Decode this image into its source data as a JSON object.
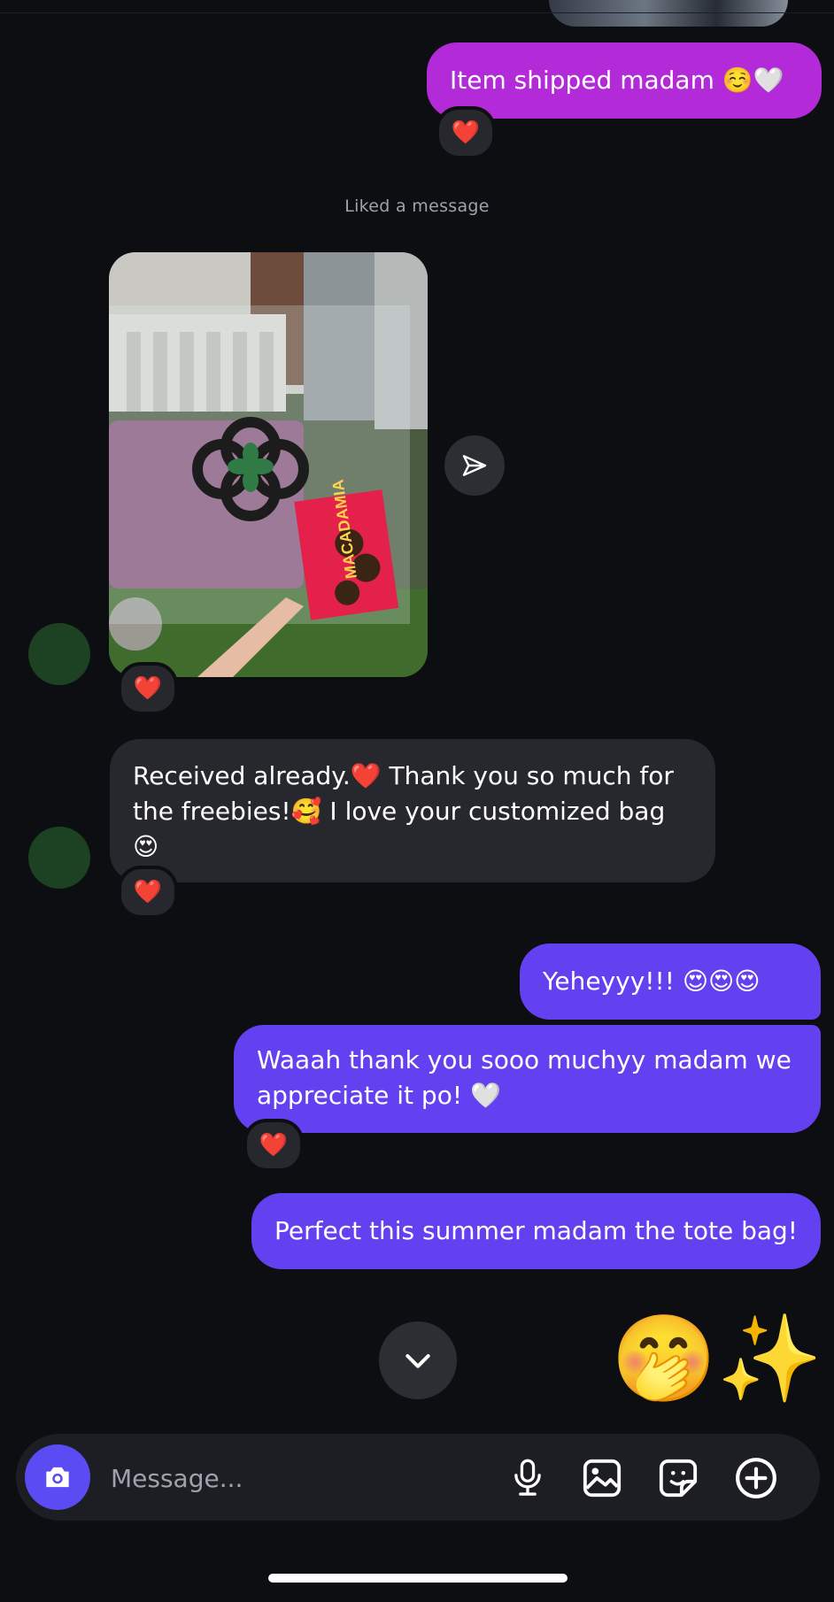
{
  "thread": {
    "messages": {
      "item_shipped": {
        "text": "Item shipped madam ☺️🤍",
        "reaction": "❤️"
      },
      "liked_meta": "Liked a message",
      "received": {
        "text": "Received already.❤️ Thank you so much for the freebies!🥰 I love your customized bag 😍",
        "reaction": "❤️"
      },
      "yeheyyy": {
        "text": "Yeheyyy!!! 😍😍😍"
      },
      "waaah": {
        "text": "Waaah thank you sooo muchyy madam we appreciate it po! 🤍",
        "reaction": "❤️"
      },
      "perfect": {
        "text": "Perfect this summer madam the tote bag!"
      },
      "emoji_reply": "🤭✨"
    },
    "photo": {
      "box_label": "MACADAMIA",
      "reaction": "❤️"
    }
  },
  "composer": {
    "placeholder": "Message...",
    "icons": [
      "camera-icon",
      "microphone-icon",
      "gallery-icon",
      "sticker-icon",
      "add-icon"
    ]
  },
  "colors": {
    "background": "#0c0e12",
    "outgoing_magenta": "#b32ad9",
    "outgoing_violet": "#6441f0",
    "incoming_gray": "#26282d",
    "camera_button": "#5a4bf2"
  }
}
